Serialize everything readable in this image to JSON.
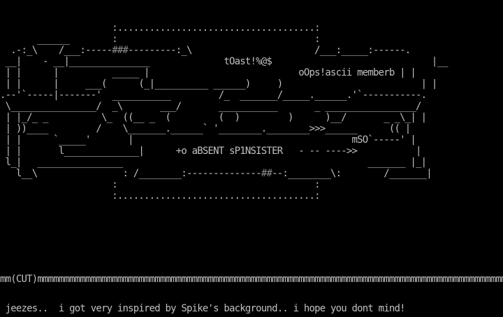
{
  "art": {
    "line_01": "                     :.....................................:",
    "line_02": "       ______        :                                     :",
    "line_03": "  .-:_\\    /___:-----",
    "line_03_shade": "###",
    "line_03_rest": "---------:_\\                       /___:_____:------.",
    "line_04": " __|    - __|_______________              tOast!%@$                              |__",
    "line_05": " | |      |          _____ |                            oOps!ascii memberb | |",
    "line_06": " | |      |     ___(      (_|__________ ______)     )                          | |",
    "line_07": ".--'`-----|-------'  ___________         /_  _______/_____.______.'`-----------.",
    "line_08": " \\________________/  _\\       ___/       ___________       _ _________________/",
    "line_09": " | |_/_ _          \\_  ((__ _  (         (  )         )      )__/       _ _\\_| |",
    "line_10": " | ))____         /    \\_______.______` '________.________>>>______      (( |",
    "line_11": " | |      `_____'       |                                         mSO`-----' |",
    "line_12": " | |       l______________|      +o aBSENT sP1NSISTER   - -- ---->>           |",
    "line_13": " l_|   ________________                                              _______ |_|",
    "line_14": "   l__\\                : /________:--------------",
    "line_14_shade": "##",
    "line_14_rest": "--:________\\:        /_______|",
    "line_15": "                     :                                     :",
    "line_16": "                     :.....................................:"
  },
  "cut_line": "mm(CUT)mmmmmmmmmmmmmmmmmmmmmmmmmmmmmmmmmmmmmmmmmmmmmmmmmmmmmmmmmmmmmmmmmmmmmmmmmmmmmmmmmmmmmmmmmmm",
  "footer": {
    "message": " jeezes..  i got very inspired by Spike's background.. i hope you dont mind!"
  },
  "colors": {
    "background": "#000000",
    "text": "#c0c0c0",
    "shade_block": "#8c8c8c"
  }
}
